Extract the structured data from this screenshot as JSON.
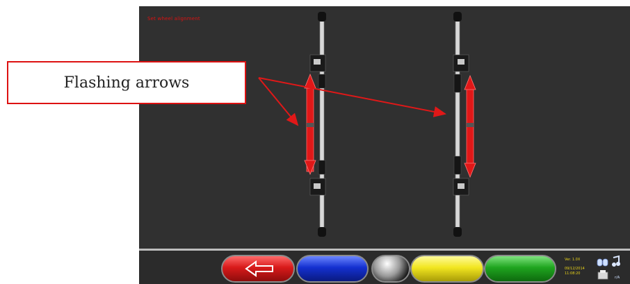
{
  "screen": {
    "title": "Set wheel alignment",
    "status": {
      "version": "Ver. 1.0X",
      "date": "09/12/2014",
      "time": "11:08:20",
      "device": "r/A"
    }
  },
  "annotation": {
    "callout_text": "Flashing arrows"
  },
  "toolbar": {
    "buttons": [
      {
        "name": "back",
        "color": "#d81a1a",
        "icon": "arrow-left-icon"
      },
      {
        "name": "blue",
        "color": "#1430d0",
        "icon": ""
      },
      {
        "name": "grey",
        "color": "#9a9a9a",
        "icon": ""
      },
      {
        "name": "yellow",
        "color": "#f2e620",
        "icon": ""
      },
      {
        "name": "green",
        "color": "#1fa51f",
        "icon": ""
      }
    ]
  },
  "colors": {
    "screen_bg": "#303030",
    "arrow_red": "#e01818",
    "callout_border": "#dd1111"
  }
}
